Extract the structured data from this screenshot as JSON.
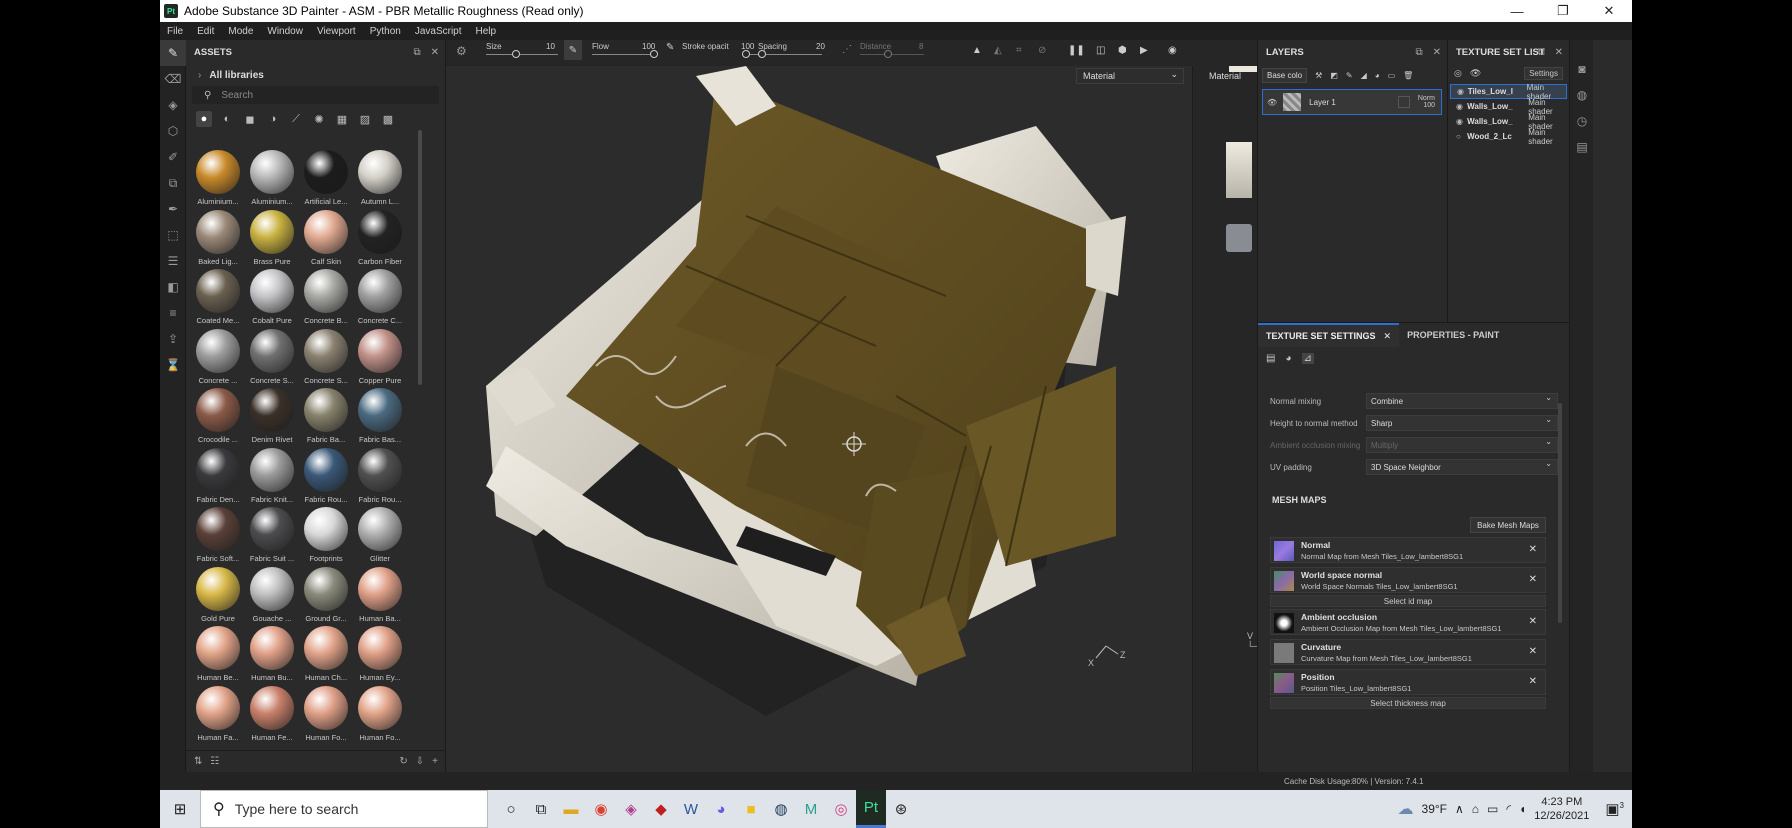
{
  "window": {
    "title": "Adobe Substance 3D Painter - ASM - PBR Metallic Roughness (Read only)",
    "logo": "Pt"
  },
  "menu": [
    "File",
    "Edit",
    "Mode",
    "Window",
    "Viewport",
    "Python",
    "JavaScript",
    "Help"
  ],
  "assets": {
    "title": "ASSETS",
    "library": "All libraries",
    "search_placeholder": "Search",
    "materials": [
      {
        "name": "Aluminium...",
        "color": "#c88a2a"
      },
      {
        "name": "Aluminium...",
        "color": "#b8b8b8"
      },
      {
        "name": "Artificial Le...",
        "color": "#1c1c1c"
      },
      {
        "name": "Autumn L...",
        "color": "#d4d0c8"
      },
      {
        "name": "Baked Lig...",
        "color": "#9a8878"
      },
      {
        "name": "Brass Pure",
        "color": "#c8b040"
      },
      {
        "name": "Calf Skin",
        "color": "#e0a890"
      },
      {
        "name": "Carbon Fiber",
        "color": "#222222"
      },
      {
        "name": "Coated Me...",
        "color": "#6a6050"
      },
      {
        "name": "Cobalt Pure",
        "color": "#c4c4c8"
      },
      {
        "name": "Concrete B...",
        "color": "#a8a8a4"
      },
      {
        "name": "Concrete C...",
        "color": "#a0a0a0"
      },
      {
        "name": "Concrete ...",
        "color": "#9c9c9c"
      },
      {
        "name": "Concrete S...",
        "color": "#707070"
      },
      {
        "name": "Concrete S...",
        "color": "#8a8070"
      },
      {
        "name": "Copper Pure",
        "color": "#c09088"
      },
      {
        "name": "Crocodile ...",
        "color": "#8a5a48"
      },
      {
        "name": "Denim Rivet",
        "color": "#3a3028"
      },
      {
        "name": "Fabric Ba...",
        "color": "#86826c"
      },
      {
        "name": "Fabric Bas...",
        "color": "#4a6a80"
      },
      {
        "name": "Fabric Den...",
        "color": "#3a3a3e"
      },
      {
        "name": "Fabric Knit...",
        "color": "#9a9a9a"
      },
      {
        "name": "Fabric Rou...",
        "color": "#3a5878"
      },
      {
        "name": "Fabric Rou...",
        "color": "#505050"
      },
      {
        "name": "Fabric Soft...",
        "color": "#5a4038"
      },
      {
        "name": "Fabric Suit ...",
        "color": "#4c4c50"
      },
      {
        "name": "Footprints",
        "color": "#d8d8d8"
      },
      {
        "name": "Glitter",
        "color": "#b0b0b0"
      },
      {
        "name": "Gold Pure",
        "color": "#d8b848"
      },
      {
        "name": "Gouache ...",
        "color": "#c0c0c0"
      },
      {
        "name": "Ground Gr...",
        "color": "#8a8a7c"
      },
      {
        "name": "Human Ba...",
        "color": "#e0a088"
      },
      {
        "name": "Human Be...",
        "color": "#e2a48a"
      },
      {
        "name": "Human Bu...",
        "color": "#e0a088"
      },
      {
        "name": "Human Ch...",
        "color": "#e2a48a"
      },
      {
        "name": "Human Ey...",
        "color": "#e0a088"
      },
      {
        "name": "Human Fa...",
        "color": "#e2a48a"
      },
      {
        "name": "Human Fe...",
        "color": "#c8806a"
      },
      {
        "name": "Human Fo...",
        "color": "#e0a088"
      },
      {
        "name": "Human Fo...",
        "color": "#e2a48a"
      }
    ]
  },
  "toolbar": {
    "size_label": "Size",
    "size_value": "10",
    "flow_label": "Flow",
    "flow_value": "100",
    "stroke_label": "Stroke opacit",
    "stroke_value": "100",
    "spacing_label": "Spacing",
    "spacing_value": "20",
    "distance_label": "Distance",
    "distance_value": "8"
  },
  "viewport": {
    "material_dropdown_1": "Material",
    "material_dropdown_2": "Material"
  },
  "layers": {
    "title": "LAYERS",
    "channel": "Base colo",
    "layer_name": "Layer 1",
    "blend_mode": "Norm",
    "opacity": "100"
  },
  "texture_set_list": {
    "title": "TEXTURE SET LIST",
    "settings_label": "Settings",
    "sets": [
      {
        "name": "Tiles_Low_l",
        "shader": "Main shader"
      },
      {
        "name": "Walls_Low_",
        "shader": "Main shader"
      },
      {
        "name": "Walls_Low_",
        "shader": "Main shader"
      },
      {
        "name": "Wood_2_Lc",
        "shader": "Main shader"
      }
    ]
  },
  "texture_set_settings": {
    "tab1": "TEXTURE SET SETTINGS",
    "tab2": "PROPERTIES - PAINT",
    "normal_mixing_label": "Normal mixing",
    "normal_mixing_value": "Combine",
    "height_label": "Height to normal method",
    "height_value": "Sharp",
    "ao_mixing_label": "Ambient occlusion mixing",
    "ao_mixing_value": "Multiply",
    "uv_padding_label": "UV padding",
    "uv_padding_value": "3D Space Neighbor",
    "mesh_maps_title": "MESH MAPS",
    "bake_button": "Bake Mesh Maps",
    "maps": [
      {
        "title": "Normal",
        "desc": "Normal Map from Mesh Tiles_Low_lambert8SG1"
      },
      {
        "title": "World space normal",
        "desc": "World Space Normals Tiles_Low_lambert8SG1"
      },
      {
        "title": "Ambient occlusion",
        "desc": "Ambient Occlusion Map from Mesh Tiles_Low_lambert8SG1"
      },
      {
        "title": "Curvature",
        "desc": "Curvature Map from Mesh Tiles_Low_lambert8SG1"
      },
      {
        "title": "Position",
        "desc": "Position Tiles_Low_lambert8SG1"
      }
    ],
    "select_id_map": "Select id map",
    "select_thickness_map": "Select thickness map"
  },
  "status": {
    "cache": "Cache Disk Usage:",
    "cache_value": "80% | Version: 7.4.1"
  },
  "taskbar": {
    "search_placeholder": "Type here to search",
    "temperature": "39°F",
    "time": "4:23 PM",
    "date": "12/26/2021",
    "notifications": "3"
  }
}
